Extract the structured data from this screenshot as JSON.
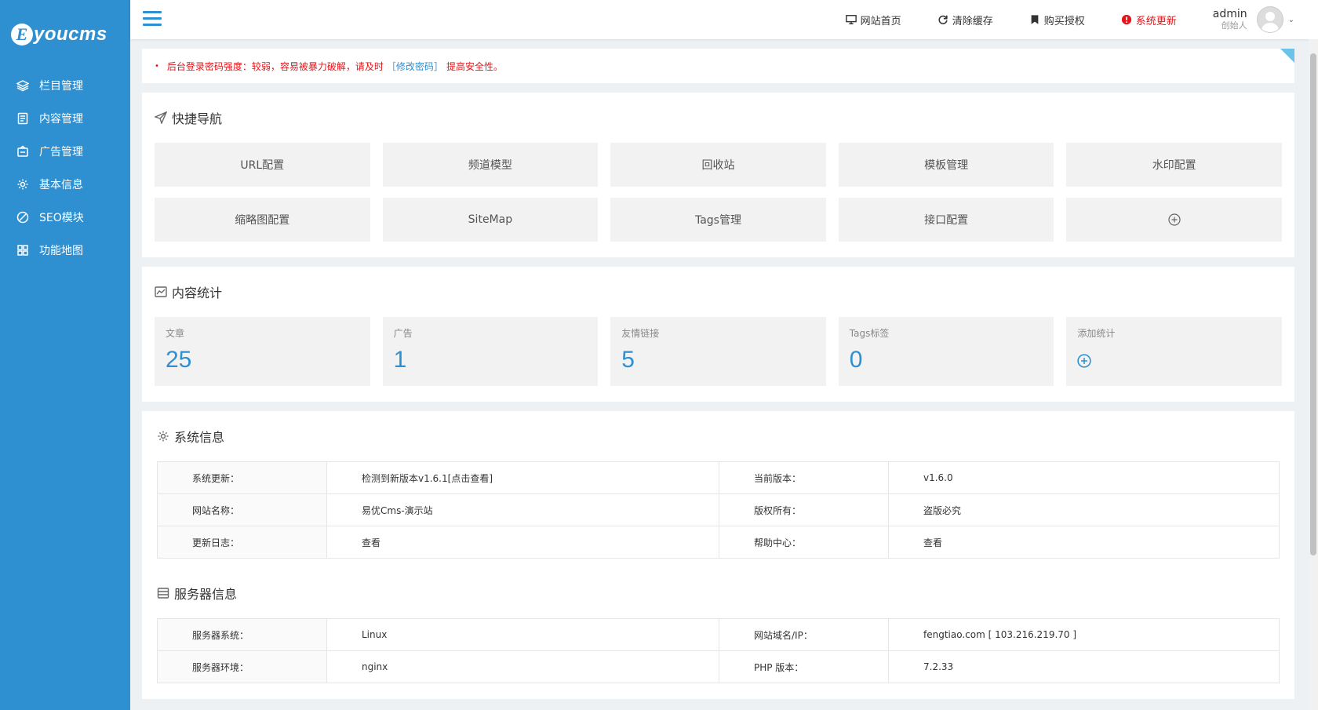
{
  "brand": {
    "logo_letter": "E",
    "logo_text": "youcms"
  },
  "sidebar": {
    "items": [
      {
        "label": "栏目管理",
        "icon": "layers-icon"
      },
      {
        "label": "内容管理",
        "icon": "document-icon"
      },
      {
        "label": "广告管理",
        "icon": "ad-icon"
      },
      {
        "label": "基本信息",
        "icon": "gear-icon"
      },
      {
        "label": "SEO模块",
        "icon": "seo-icon"
      },
      {
        "label": "功能地图",
        "icon": "grid-icon"
      }
    ]
  },
  "topbar": {
    "links": [
      {
        "label": "网站首页",
        "icon": "monitor-icon"
      },
      {
        "label": "清除缓存",
        "icon": "refresh-icon"
      },
      {
        "label": "购买授权",
        "icon": "bookmark-icon"
      },
      {
        "label": "系统更新",
        "icon": "alert-icon"
      }
    ],
    "user": {
      "name": "admin",
      "role": "创始人"
    }
  },
  "notice": {
    "prefix": "后台登录密码强度：较弱，容易被暴力破解，请及时",
    "link": "［修改密码］",
    "suffix": "提高安全性。"
  },
  "quick_nav": {
    "title": "快捷导航",
    "items": [
      "URL配置",
      "频道模型",
      "回收站",
      "模板管理",
      "水印配置",
      "缩略图配置",
      "SiteMap",
      "Tags管理",
      "接口配置"
    ]
  },
  "stats": {
    "title": "内容统计",
    "items": [
      {
        "label": "文章",
        "value": "25"
      },
      {
        "label": "广告",
        "value": "1"
      },
      {
        "label": "友情链接",
        "value": "5"
      },
      {
        "label": "Tags标签",
        "value": "0"
      }
    ],
    "add_label": "添加统计"
  },
  "system_info": {
    "title": "系统信息",
    "rows": [
      {
        "k1": "系统更新：",
        "v1": "检测到新版本v1.6.1[点击查看]",
        "k2": "当前版本：",
        "v2": "v1.6.0"
      },
      {
        "k1": "网站名称：",
        "v1": "易优Cms-演示站",
        "k2": "版权所有：",
        "v2": "盗版必究"
      },
      {
        "k1": "更新日志：",
        "v1": "查看",
        "k2": "帮助中心：",
        "v2": "查看"
      }
    ]
  },
  "server_info": {
    "title": "服务器信息",
    "rows": [
      {
        "k1": "服务器系统：",
        "v1": "Linux",
        "k2": "网站域名/IP：",
        "v2": "fengtiao.com [ 103.216.219.70 ]"
      },
      {
        "k1": "服务器环境：",
        "v1": "nginx",
        "k2": "PHP 版本：",
        "v2": "7.2.33"
      }
    ]
  },
  "colors": {
    "accent": "#2e8fd1",
    "alert": "#e4161b"
  }
}
